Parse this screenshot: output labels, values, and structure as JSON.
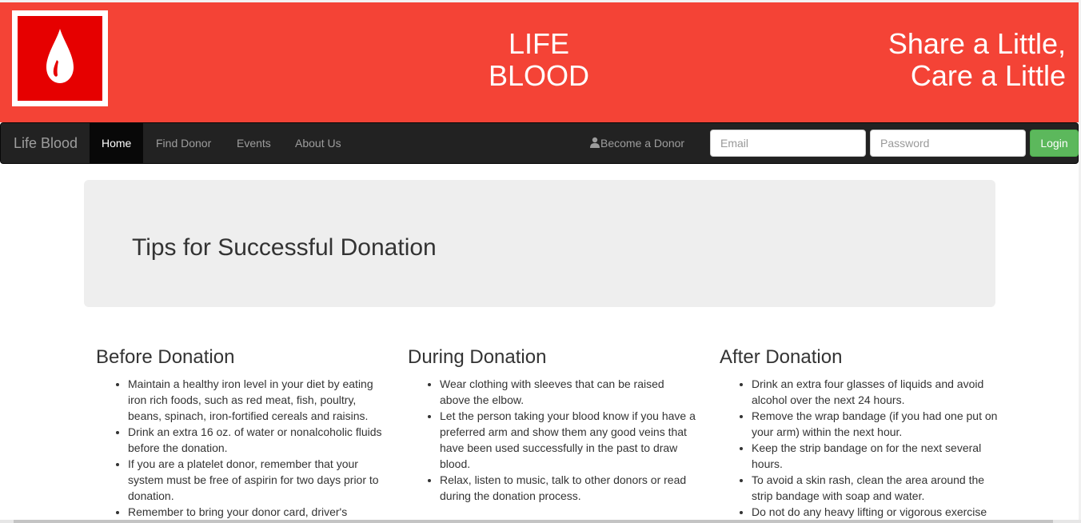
{
  "header": {
    "brand_title_line1": "LIFE",
    "brand_title_line2": "BLOOD",
    "tagline_line1": "Share a Little,",
    "tagline_line2": "Care a Little",
    "banner_color": "#f44336",
    "logo_icon": "blood-drop-icon"
  },
  "navbar": {
    "brand": "Life Blood",
    "items": [
      {
        "label": "Home",
        "active": true
      },
      {
        "label": "Find Donor",
        "active": false
      },
      {
        "label": "Events",
        "active": false
      },
      {
        "label": "About Us",
        "active": false
      }
    ],
    "become_donor": "Become a Donor",
    "become_donor_icon": "user-icon",
    "email_placeholder": "Email",
    "password_placeholder": "Password",
    "login_label": "Login",
    "login_color": "#5cb85c"
  },
  "main": {
    "jumbotron_title": "Tips for Successful Donation",
    "sections": [
      {
        "heading": "Before Donation",
        "tips": [
          "Maintain a healthy iron level in your diet by eating iron rich foods, such as red meat, fish, poultry, beans, spinach, iron-fortified cereals and raisins.",
          "Drink an extra 16 oz. of water or nonalcoholic fluids before the donation.",
          "If you are a platelet donor, remember that your system must be free of aspirin for two days prior to donation.",
          "Remember to bring your donor card, driver's"
        ]
      },
      {
        "heading": "During Donation",
        "tips": [
          "Wear clothing with sleeves that can be raised above the elbow.",
          "Let the person taking your blood know if you have a preferred arm and show them any good veins that have been used successfully in the past to draw blood.",
          "Relax, listen to music, talk to other donors or read during the donation process."
        ]
      },
      {
        "heading": "After Donation",
        "tips": [
          "Drink an extra four glasses of liquids and avoid alcohol over the next 24 hours.",
          "Remove the wrap bandage (if you had one put on your arm) within the next hour.",
          "Keep the strip bandage on for the next several hours.",
          "To avoid a skin rash, clean the area around the strip bandage with soap and water.",
          "Do not do any heavy lifting or vigorous exercise"
        ]
      }
    ]
  }
}
